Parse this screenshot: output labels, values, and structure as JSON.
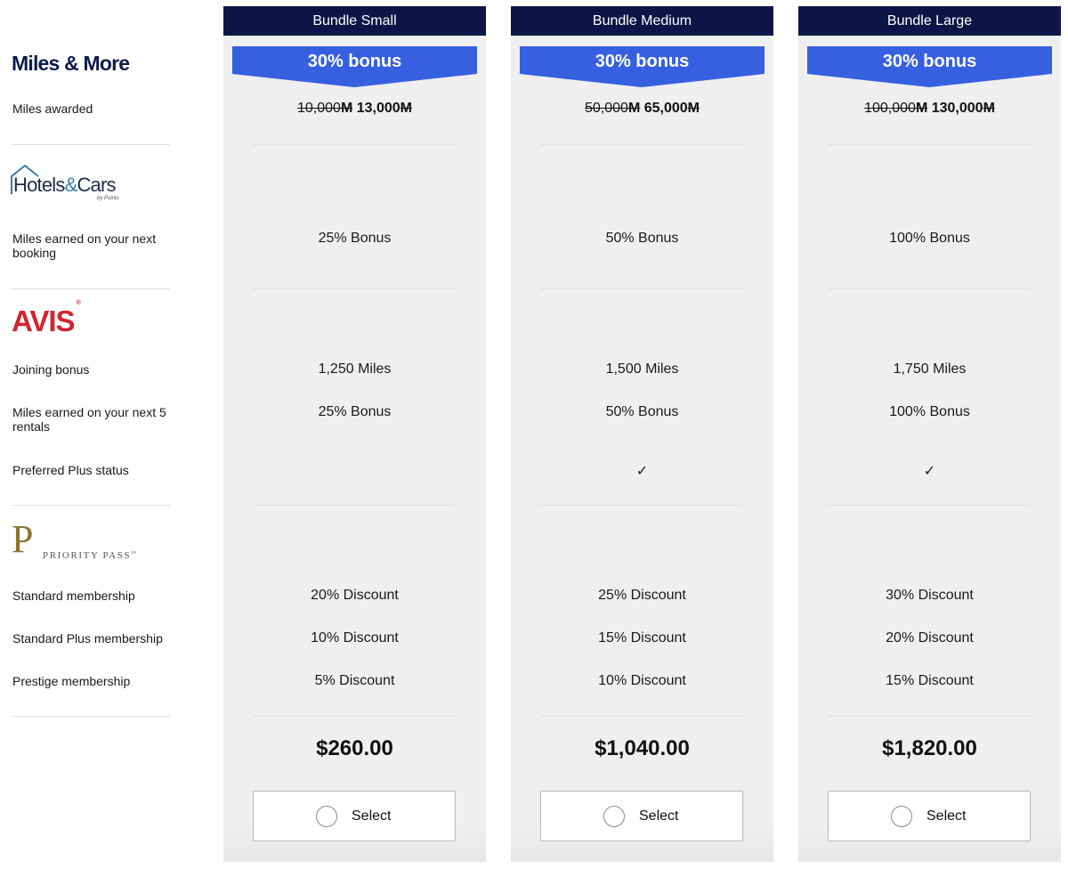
{
  "brands": {
    "miles_more": "Miles & More",
    "hotels_cars": {
      "name_a": "Hotels",
      "amp": "&",
      "name_b": "Cars",
      "byline": "by Points"
    },
    "avis": {
      "name": "AVIS",
      "reg": "®"
    },
    "priority_pass": {
      "letter": "P",
      "name": "PRIORITY PASS",
      "tm": "™"
    }
  },
  "row_labels": {
    "miles_awarded": "Miles awarded",
    "hc_next_booking": "Miles earned on your next booking",
    "avis_joining_bonus": "Joining bonus",
    "avis_next_rentals": "Miles earned on your next 5 rentals",
    "avis_preferred_plus": "Preferred Plus status",
    "pp_standard": "Standard membership",
    "pp_standard_plus": "Standard Plus membership",
    "pp_prestige": "Prestige membership"
  },
  "colors": {
    "header_navy": "#0b1547",
    "ribbon_blue": "#3660e0",
    "column_bg": "#efefef",
    "avis_red": "#d22630",
    "priority_gold": "#8c7432"
  },
  "bundles": [
    {
      "title": "Bundle Small",
      "bonus_badge": "30% bonus",
      "miles_old": "10,000",
      "miles_new": "13,000",
      "miles_unit": "M",
      "hc_next_booking": "25% Bonus",
      "avis_joining_bonus": "1,250 Miles",
      "avis_next_rentals": "25% Bonus",
      "avis_preferred_plus": "",
      "pp_standard": "20% Discount",
      "pp_standard_plus": "10% Discount",
      "pp_prestige": "5% Discount",
      "price": "$260.00",
      "select_label": "Select",
      "selected": false
    },
    {
      "title": "Bundle Medium",
      "bonus_badge": "30% bonus",
      "miles_old": "50,000",
      "miles_new": "65,000",
      "miles_unit": "M",
      "hc_next_booking": "50% Bonus",
      "avis_joining_bonus": "1,500 Miles",
      "avis_next_rentals": "50% Bonus",
      "avis_preferred_plus": "✓",
      "pp_standard": "25% Discount",
      "pp_standard_plus": "15% Discount",
      "pp_prestige": "10% Discount",
      "price": "$1,040.00",
      "select_label": "Select",
      "selected": false
    },
    {
      "title": "Bundle Large",
      "bonus_badge": "30% bonus",
      "miles_old": "100,000",
      "miles_new": "130,000",
      "miles_unit": "M",
      "hc_next_booking": "100% Bonus",
      "avis_joining_bonus": "1,750 Miles",
      "avis_next_rentals": "100% Bonus",
      "avis_preferred_plus": "✓",
      "pp_standard": "30% Discount",
      "pp_standard_plus": "20% Discount",
      "pp_prestige": "15% Discount",
      "price": "$1,820.00",
      "select_label": "Select",
      "selected": false
    }
  ]
}
